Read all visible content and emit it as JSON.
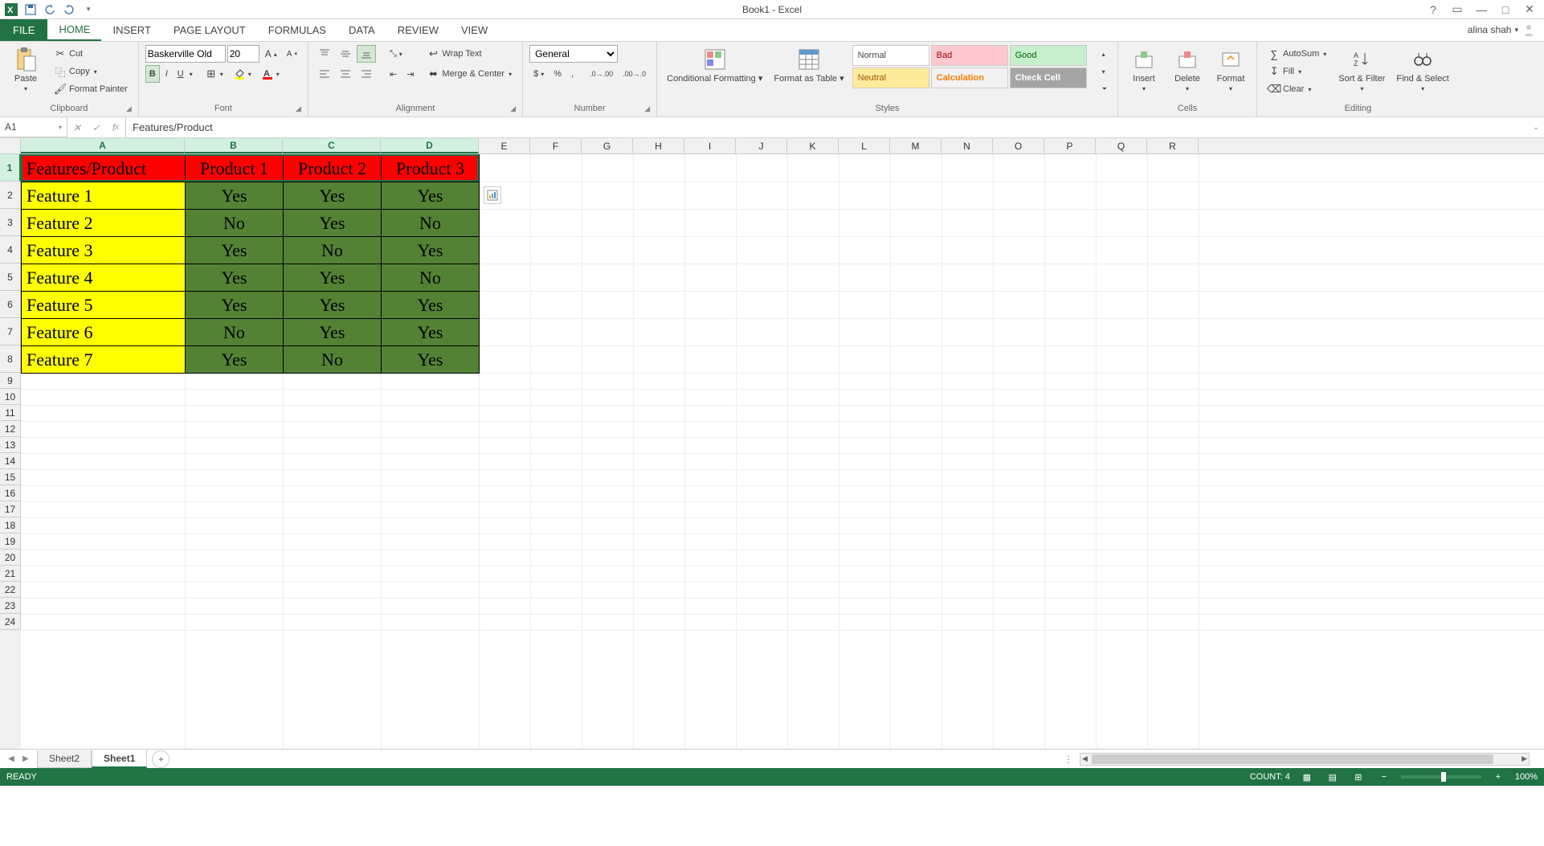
{
  "app": {
    "title": "Book1 - Excel",
    "user": "alina shah"
  },
  "qat": {
    "save": "save",
    "undo": "undo",
    "redo": "redo"
  },
  "tabs": {
    "file": "FILE",
    "home": "HOME",
    "insert": "INSERT",
    "pagelayout": "PAGE LAYOUT",
    "formulas": "FORMULAS",
    "data": "DATA",
    "review": "REVIEW",
    "view": "VIEW"
  },
  "ribbon": {
    "clipboard": {
      "label": "Clipboard",
      "paste": "Paste",
      "cut": "Cut",
      "copy": "Copy",
      "fp": "Format Painter"
    },
    "font": {
      "label": "Font",
      "name": "Baskerville Old",
      "size": "20",
      "bold": "B",
      "italic": "I",
      "underline": "U"
    },
    "alignment": {
      "label": "Alignment",
      "wrap": "Wrap Text",
      "merge": "Merge & Center"
    },
    "number": {
      "label": "Number",
      "format": "General"
    },
    "styles": {
      "label": "Styles",
      "cond": "Conditional Formatting",
      "fat": "Format as Table",
      "normal": "Normal",
      "bad": "Bad",
      "good": "Good",
      "neutral": "Neutral",
      "calc": "Calculation",
      "check": "Check Cell"
    },
    "cells": {
      "label": "Cells",
      "insert": "Insert",
      "delete": "Delete",
      "format": "Format"
    },
    "editing": {
      "label": "Editing",
      "autosum": "AutoSum",
      "fill": "Fill",
      "clear": "Clear",
      "sort": "Sort & Filter",
      "find": "Find & Select"
    }
  },
  "formula_bar": {
    "namebox": "A1",
    "formula": "Features/Product"
  },
  "columns": [
    "A",
    "B",
    "C",
    "D",
    "E",
    "F",
    "G",
    "H",
    "I",
    "J",
    "K",
    "L",
    "M",
    "N",
    "O",
    "P",
    "Q",
    "R"
  ],
  "col_widths": {
    "A": 204,
    "B": 122,
    "C": 122,
    "D": 122,
    "default": 64
  },
  "data_rows": 8,
  "empty_rows_visible": 16,
  "chart_data": {
    "type": "table",
    "headers": [
      "Features/Product",
      "Product 1",
      "Product 2",
      "Product 3"
    ],
    "rows": [
      [
        "Feature 1",
        "Yes",
        "Yes",
        "Yes"
      ],
      [
        "Feature 2",
        "No",
        "Yes",
        "No"
      ],
      [
        "Feature 3",
        "Yes",
        "No",
        "Yes"
      ],
      [
        "Feature 4",
        "Yes",
        "Yes",
        "No"
      ],
      [
        "Feature 5",
        "Yes",
        "Yes",
        "Yes"
      ],
      [
        "Feature 6",
        "No",
        "Yes",
        "Yes"
      ],
      [
        "Feature 7",
        "Yes",
        "No",
        "Yes"
      ]
    ]
  },
  "sheets": {
    "tabs": [
      "Sheet2",
      "Sheet1"
    ],
    "active": "Sheet1"
  },
  "status": {
    "ready": "READY",
    "count_label": "COUNT:",
    "count": "4",
    "zoom": "100%"
  },
  "selection": {
    "range": "A1:D1"
  }
}
